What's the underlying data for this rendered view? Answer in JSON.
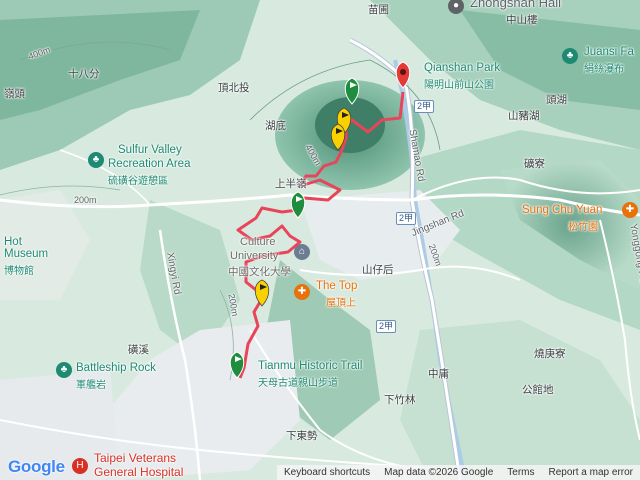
{
  "map": {
    "provider_logo": "Google",
    "attribution": {
      "shortcuts": "Keyboard shortcuts",
      "map_data": "Map data ©2026 Google",
      "terms": "Terms",
      "report": "Report a map error"
    },
    "colors": {
      "terrain_light": "#e4f0e8",
      "terrain_dark": "#5f9d84",
      "urban": "#eceff0",
      "road": "#ffffff",
      "highway": "#aab8c8",
      "river": "#9dc8e8",
      "trail": "#e8455a",
      "flag_green": "#1e8e3e",
      "flag_yellow": "#f9d000",
      "end_marker": "#e53935",
      "poi_green": "#1e8a74",
      "poi_orange": "#e8710a",
      "hospital_red": "#d93025"
    },
    "pois": {
      "zhongshan": "Zhongshan Hall",
      "zhongshan_zh": "中山樓",
      "qianshan": "Qianshan Park",
      "qianshan_zh": "陽明山前山公園",
      "juansi": "Juansi Fa",
      "juansi_zh": "絹絲瀑布",
      "sulfur_1": "Sulfur Valley",
      "sulfur_2": "Recreation Area",
      "sulfur_zh": "硫磺谷遊憩區",
      "hot_1": "Hot",
      "hot_2": "Museum",
      "hot_zh": "博物館",
      "culture_1": "Culture",
      "culture_2": "University",
      "culture_zh": "中國文化大學",
      "thetop": "The Top",
      "thetop_zh": "屋頂上",
      "sungchu": "Sung Chu Yuan",
      "sungchu_zh": "松竹園",
      "battleship": "Battleship Rock",
      "battleship_zh": "軍艦岩",
      "tianmu_1": "Tianmu Historic Trail",
      "tianmu_zh": "天母古道親山步道",
      "hosp_1": "Taipei Veterans",
      "hosp_2": "General Hospital"
    },
    "places": {
      "miaopu": "苗圃",
      "shibafen": "十八分",
      "lingtou": "嶺頭",
      "dingbeitou": "頂北投",
      "hudi": "湖底",
      "shangbanling": "上半嶺",
      "shanzaihou": "山仔后",
      "zhuhu": "頭湖",
      "shizhuhu": "山豬湖",
      "dingliao": "礦寮",
      "shaogengliao": "燒庚寮",
      "zhonglu": "中庸",
      "gongguandi": "公館地",
      "xiazhulin": "下竹林",
      "xiadongshi": "下東勢",
      "zixi": "磺溪"
    },
    "roads": {
      "shamao": "Shamao Rd",
      "jingshan": "Jingshan Rd",
      "xingyi": "Xingyi Rd",
      "yongong": "Yonggong Rd",
      "shield_2jia": "2甲",
      "shield_2": "2甲"
    },
    "contours": {
      "c400a": "400m",
      "c400b": "400m",
      "c200a": "200m",
      "c200b": "200m",
      "c200c": "200m"
    },
    "trail": {
      "start_flag_color": "green",
      "end_marker_color": "red",
      "waypoints_shown": 7
    }
  }
}
